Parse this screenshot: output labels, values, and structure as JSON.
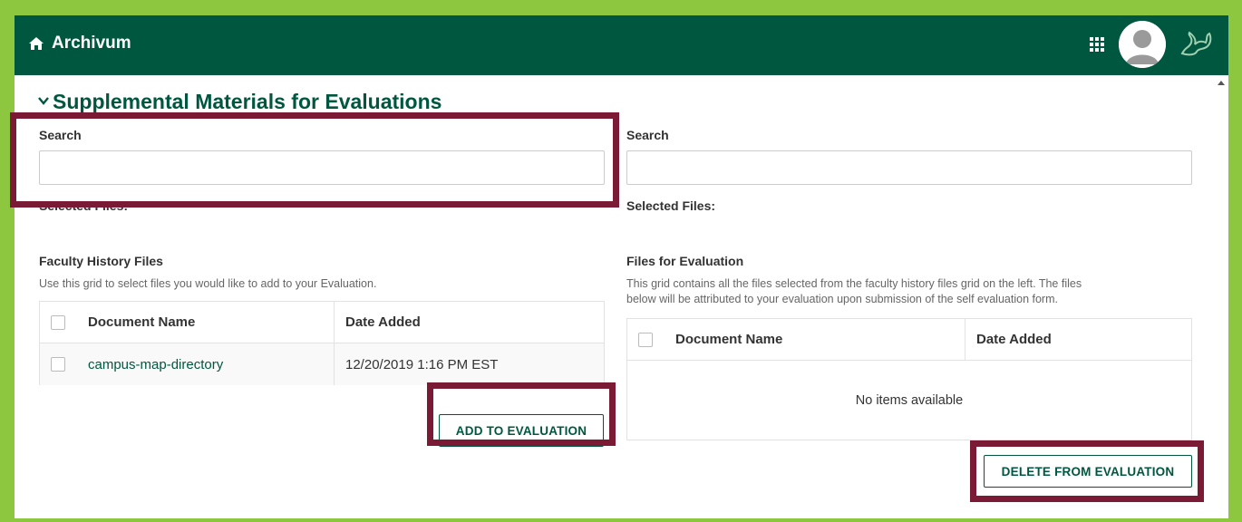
{
  "app": {
    "title": "Archivum"
  },
  "colors": {
    "brand": "#00573f",
    "frame": "#8dc63f",
    "highlight": "#7a1a34"
  },
  "icons": {
    "home": "home-icon",
    "apps": "apps-grid-icon",
    "avatar": "user-avatar-icon",
    "logo": "bull-horns-logo-icon",
    "chevron": "chevron-down-icon"
  },
  "section": {
    "title": "Supplemental Materials for Evaluations"
  },
  "left": {
    "search_label": "Search",
    "search_value": "",
    "selected_files_label": "Selected Files:",
    "grid_title": "Faculty History Files",
    "grid_desc": "Use this grid to select files you would like to add to your Evaluation.",
    "columns": [
      "Document Name",
      "Date Added"
    ],
    "rows": [
      {
        "name": "campus-map-directory",
        "date": "12/20/2019 1:16 PM EST"
      }
    ],
    "button": "ADD TO EVALUATION"
  },
  "right": {
    "search_label": "Search",
    "search_value": "",
    "selected_files_label": "Selected Files:",
    "grid_title": "Files for Evaluation",
    "grid_desc_line1": "This grid contains all the files selected from the faculty history files grid on the left. The files",
    "grid_desc_line2": "below will be attributed to your evaluation upon submission of the self evaluation form.",
    "columns": [
      "Document Name",
      "Date Added"
    ],
    "empty_text": "No items available",
    "button": "DELETE FROM EVALUATION"
  }
}
